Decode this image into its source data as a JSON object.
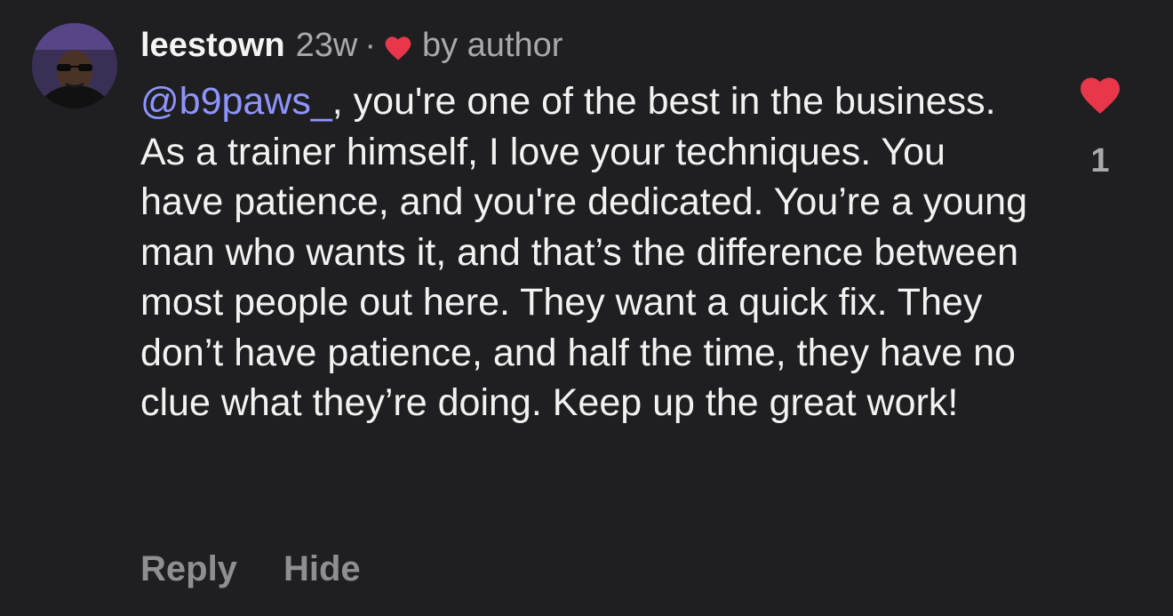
{
  "comment": {
    "username": "leestown",
    "timestamp": "23w",
    "separator": "·",
    "liked_by": "by author",
    "mention": "@b9paws_",
    "text": ", you're one of the best in the business. As a trainer himself, I love your techniques. You have patience, and you're dedicated. You’re a young man who wants it, and that’s the difference between most people out here. They want a quick fix. They don’t have patience, and half the time, they have no clue what they’re doing. Keep up the great work!",
    "like_count": "1",
    "actions": {
      "reply_label": "Reply",
      "hide_label": "Hide"
    }
  },
  "colors": {
    "background": "#1f1f21",
    "heart": "#e8374a",
    "mention": "#8e94ff",
    "muted": "#a8a8ad"
  },
  "icons": {
    "author_like": "heart-icon",
    "like_button": "heart-filled-icon"
  }
}
